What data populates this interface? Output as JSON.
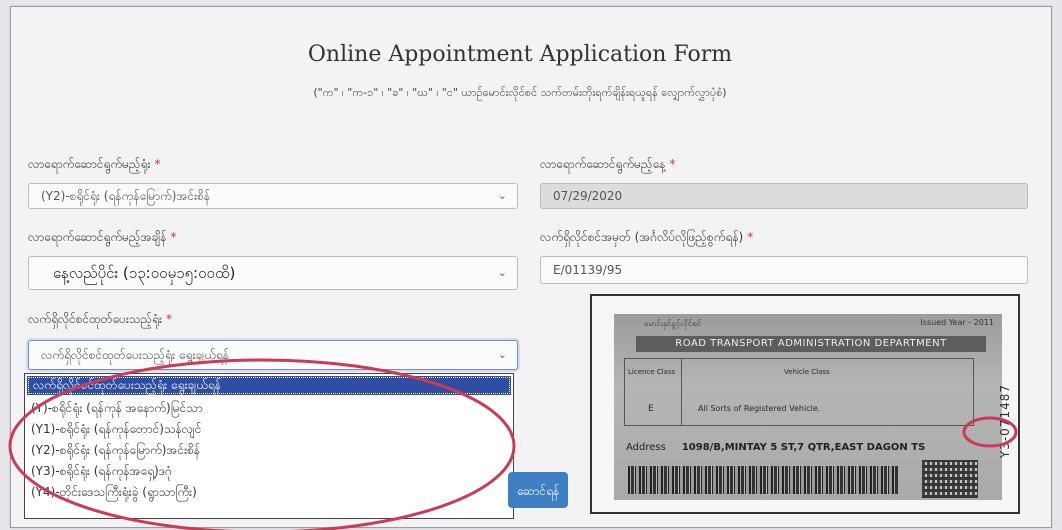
{
  "form": {
    "title": "Online Appointment Application Form",
    "subtitle": "(\"က\" ၊ \"က-၁\" ၊ \"ခ\" ၊ \"ဃ\" ၊ \"င\" ယာဉ်မောင်းလိုင်စင် သက်တမ်းတိုးရက်ချိန်းရယူရန် လျှောက်လွှာပုံစံ)",
    "required_mark": "*"
  },
  "fields": {
    "office": {
      "label": "လာရောက်ဆောင်ရွက်မည့်ရုံး",
      "value": "(Y2)-စရိုင်ရုံး (ရန်ကုန်မြောက်)အင်းစိန်",
      "chevron": "⌄"
    },
    "date": {
      "label": "လာရောက်ဆောင်ရွက်မည့်နေ့",
      "value": "07/29/2020"
    },
    "time": {
      "label": "လာရောက်ဆောင်ရွက်မည့်အချိန်",
      "value": "နေ့လည်ပိုင်း (၁၃:၀၀မှ၁၅:၀၀ထိ)",
      "chevron": "⌄"
    },
    "license_no": {
      "label": "လက်ရှိလိုင်စင်အမှတ် (အင်္ဂလိပ်လိုဖြည့်စွက်ရန်)",
      "value": "E/01139/95"
    },
    "issuing_office": {
      "label": "လက်ရှိလိုင်စင်ထုတ်ပေးသည့်ရုံး",
      "value": "လက်ရှိလိုင်စင်ထုတ်ပေးသည့်ရုံး ရွေးချယ်ရန်",
      "chevron": "⌄",
      "options": [
        "လက်ရှိလိုင်စင်ထုတ်ပေးသည့်ရုံး ရွေးချယ်ရန်",
        "(Y)-စရိုင်ရုံး (ရန်ကုန် အနောက်)မြင်သာ",
        "(Y1)-စရိုင်ရုံး (ရန်ကုန်တောင်)သန်လျင်",
        "(Y2)-စရိုင်ရုံး (ရန်ကုန်မြောက်)အင်းစိန်",
        "(Y3)-စရိုင်ရုံး (ရန်ကုန်အရှေ့)ဒဂုံ",
        "(Y4)-တိုင်းဒေသကြီးရုံးခွဲ (ရွာသာကြီး)"
      ]
    }
  },
  "submit": {
    "label": "ဆောင်ရန်"
  },
  "license_card": {
    "header_left": "မောင်းနှင်ခွင့်လိုင်စင်",
    "header_right": "Issued Year - 2011",
    "department": "ROAD TRANSPORT ADMINISTRATION DEPARTMENT",
    "class_label": "Licence Class",
    "vehicle_label": "Vehicle Class",
    "vehicle_desc": "All Sorts of Registered Vehicle.",
    "class_value": "E",
    "address_label": "Address",
    "address_value": "1098/B,MINTAY 5 ST,7 QTR,EAST DAGON TS",
    "side_number": "Y3-071487"
  },
  "colors": {
    "accent": "#3d7fc2",
    "required": "#d9303a",
    "selected_option": "#2f4ea3",
    "annotation": "#cc3b55"
  }
}
